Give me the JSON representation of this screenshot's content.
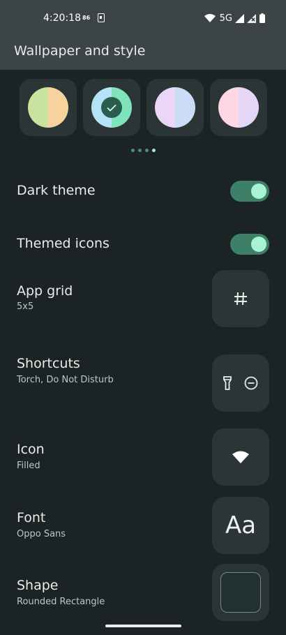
{
  "status_bar": {
    "time": "4:20:18",
    "badge": "86",
    "network": "5G"
  },
  "app_bar": {
    "title": "Wallpaper and style"
  },
  "palettes": {
    "options": [
      {
        "colors": [
          "#c9e29e",
          "#f8d29d"
        ],
        "selected": false
      },
      {
        "colors": [
          "#b6e2f5",
          "#7fe3bb"
        ],
        "selected": true
      },
      {
        "colors": [
          "#ebd6f7",
          "#cbdcf6"
        ],
        "selected": false
      },
      {
        "colors": [
          "#fdd8e3",
          "#e5d6f8"
        ],
        "selected": false
      }
    ],
    "page_count": 4,
    "active_page": 4
  },
  "settings": {
    "dark_theme": {
      "label": "Dark theme",
      "enabled": true
    },
    "themed_icons": {
      "label": "Themed icons",
      "enabled": true
    },
    "app_grid": {
      "label": "App grid",
      "value": "5x5",
      "icon": "grid-icon"
    },
    "shortcuts": {
      "label": "Shortcuts",
      "value": "Torch, Do Not Disturb",
      "icons": [
        "torch-icon",
        "do-not-disturb-icon"
      ]
    },
    "icon": {
      "label": "Icon",
      "value": "Filled",
      "icon": "wifi-icon"
    },
    "font": {
      "label": "Font",
      "value": "Oppo Sans",
      "preview": "Aa"
    },
    "shape": {
      "label": "Shape",
      "value": "Rounded Rectangle"
    }
  },
  "colors": {
    "accent": "#3e7f68",
    "accent_light": "#a6f4d2",
    "background": "#1b2324",
    "surface": "#2b3536"
  }
}
